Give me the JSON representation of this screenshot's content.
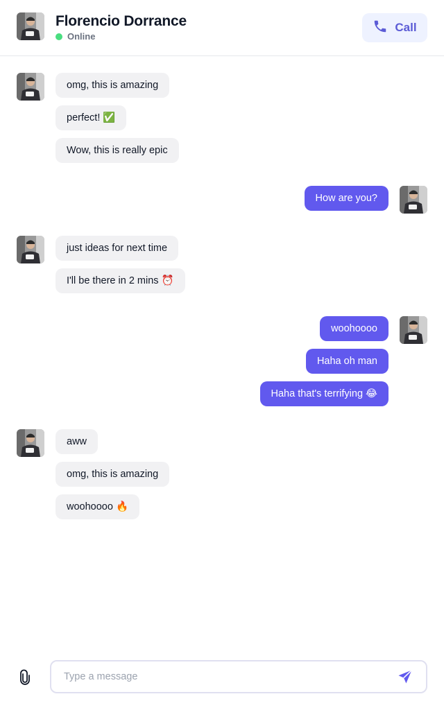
{
  "header": {
    "name": "Florencio Dorrance",
    "status": "Online",
    "call_label": "Call"
  },
  "colors": {
    "accent": "#6159ee",
    "online": "#4ade80",
    "incoming_bubble": "#f1f1f3",
    "call_bg": "#eef2ff"
  },
  "messages": [
    {
      "direction": "incoming",
      "bubbles": [
        "omg, this is amazing",
        "perfect! ✅",
        "Wow, this is really epic"
      ]
    },
    {
      "direction": "outgoing",
      "bubbles": [
        "How are you?"
      ]
    },
    {
      "direction": "incoming",
      "bubbles": [
        "just ideas for next time",
        "I'll be there in 2 mins ⏰"
      ]
    },
    {
      "direction": "outgoing",
      "bubbles": [
        "woohoooo",
        "Haha oh man",
        "Haha that's terrifying 😂"
      ]
    },
    {
      "direction": "incoming",
      "bubbles": [
        "aww",
        "omg, this is amazing",
        "woohoooo 🔥"
      ]
    }
  ],
  "composer": {
    "placeholder": "Type a message",
    "value": ""
  },
  "icons": {
    "call": "phone-icon",
    "attach": "paperclip-icon",
    "send": "send-icon",
    "avatar": "user-avatar"
  }
}
